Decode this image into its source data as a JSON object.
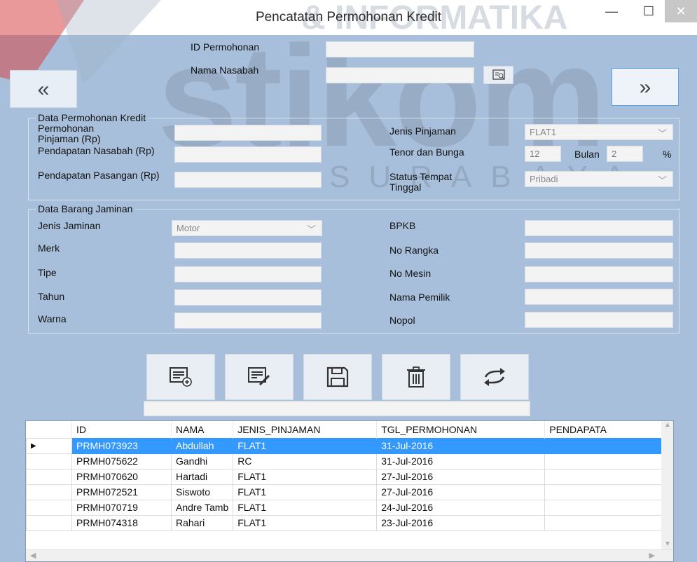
{
  "window": {
    "title": "Pencatatan Permohonan Kredit",
    "watermark_top": "& INFORMATIKA",
    "watermark_big": "stikom",
    "watermark_sub": "SURABAYA",
    "minimize": "—",
    "maximize": "☐",
    "close": "✕"
  },
  "header": {
    "id_label": "ID Permohonan",
    "id_value": "",
    "nasabah_label": "Nama Nasabah",
    "nasabah_value": "",
    "prev_label": "«",
    "next_label": "»"
  },
  "kredit": {
    "title": "Data Permohonan Kredit",
    "permohonan_label": "Permohonan Pinjaman (Rp)",
    "pendapatan_label": "Pendapatan Nasabah (Rp)",
    "pasangan_label": "Pendapatan Pasangan (Rp)",
    "jenis_label": "Jenis Pinjaman",
    "jenis_value": "FLAT1",
    "tenor_label": "Tenor dan Bunga",
    "tenor_value": "12",
    "bulan_label": "Bulan",
    "bunga_value": "2",
    "percent_label": "%",
    "status_label": "Status Tempat Tinggal",
    "status_value": "Pribadi"
  },
  "jaminan": {
    "title": "Data Barang Jaminan",
    "jenis_label": "Jenis Jaminan",
    "jenis_value": "Motor",
    "merk_label": "Merk",
    "tipe_label": "Tipe",
    "tahun_label": "Tahun",
    "warna_label": "Warna",
    "bpkb_label": "BPKB",
    "rangka_label": "No Rangka",
    "mesin_label": "No Mesin",
    "pemilik_label": "Nama Pemilik",
    "nopol_label": "Nopol"
  },
  "actions": [
    "add-icon",
    "edit-icon",
    "save-icon",
    "delete-icon",
    "refresh-icon"
  ],
  "grid": {
    "columns": [
      "ID",
      "NAMA",
      "JENIS_PINJAMAN",
      "TGL_PERMOHONAN",
      "PENDAPATA"
    ],
    "rows": [
      [
        "PRMH073923",
        "Abdullah",
        "FLAT1",
        "31-Jul-2016",
        ""
      ],
      [
        "PRMH075622",
        "Gandhi",
        "RC",
        "31-Jul-2016",
        ""
      ],
      [
        "PRMH070620",
        "Hartadi",
        "FLAT1",
        "27-Jul-2016",
        ""
      ],
      [
        "PRMH072521",
        "Siswoto",
        "FLAT1",
        "27-Jul-2016",
        ""
      ],
      [
        "PRMH070719",
        "Andre Tamb",
        "FLAT1",
        "24-Jul-2016",
        ""
      ],
      [
        "PRMH074318",
        "Rahari",
        "FLAT1",
        "23-Jul-2016",
        ""
      ]
    ],
    "selected_row": 0,
    "row_marker": "▶"
  },
  "colors": {
    "form_bg": "#a7bfdb",
    "selection": "#3399ff"
  }
}
